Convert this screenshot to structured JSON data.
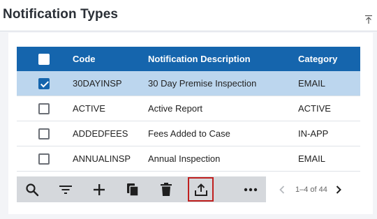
{
  "panel": {
    "title": "Notification Types"
  },
  "table": {
    "columns": [
      "Code",
      "Notification Description",
      "Category"
    ],
    "rows": [
      {
        "code": "30DAYINSP",
        "description": "30 Day Premise Inspection",
        "category": "EMAIL",
        "selected": true
      },
      {
        "code": "ACTIVE",
        "description": "Active Report",
        "category": "ACTIVE",
        "selected": false
      },
      {
        "code": "ADDEDFEES",
        "description": "Fees Added to Case",
        "category": "IN-APP",
        "selected": false
      },
      {
        "code": "ANNUALINSP",
        "description": "Annual Inspection",
        "category": "EMAIL",
        "selected": false
      }
    ]
  },
  "toolbar": {
    "icons": [
      "search-icon",
      "filter-icon",
      "add-icon",
      "copy-icon",
      "delete-icon",
      "export-icon",
      "more-icon"
    ]
  },
  "pagination": {
    "range_text": "1–4 of 44"
  },
  "colors": {
    "header_blue": "#1565ad",
    "selected_row": "#bcd6ee",
    "toolbar_bg": "#d5d8dc",
    "highlight_outline": "#c0201f"
  }
}
